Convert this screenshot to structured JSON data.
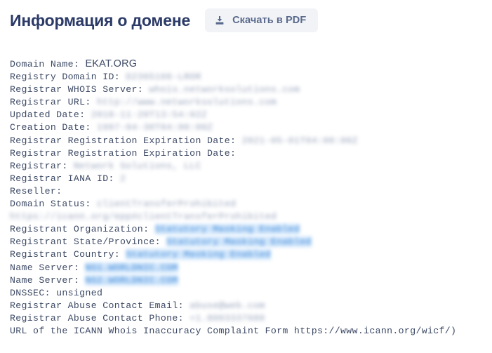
{
  "header": {
    "title": "Информация о домене",
    "pdf_button_label": "Скачать в PDF",
    "pdf_icon": "download-icon",
    "title_color": "#2b3a67",
    "button_bg": "#f1f3f7",
    "button_text_color": "#5a6a8c"
  },
  "whois": {
    "masked_value_color": "#8f9bb5",
    "highlight_value_color": "#2f7fd6",
    "highlight_bg_color": "#cfe5fb",
    "lines": [
      {
        "label": "Domain Name:",
        "value": "EKAT.ORG",
        "style": "domain"
      },
      {
        "label": "Registry Domain ID:",
        "value": "D2365166-LROR",
        "style": "masked"
      },
      {
        "label": "Registrar WHOIS Server:",
        "value": "whois.networksolutions.com",
        "style": "masked"
      },
      {
        "label": "Registrar URL:",
        "value": "http://www.networksolutions.com",
        "style": "masked"
      },
      {
        "label": "Updated Date:",
        "value": "2018-11-20T13:54:02Z",
        "style": "masked"
      },
      {
        "label": "Creation Date:",
        "value": "1997-04-30T04:00:00Z",
        "style": "masked"
      },
      {
        "label": "Registrar Registration Expiration Date:",
        "value": "2021-05-01T04:00:00Z",
        "style": "masked"
      },
      {
        "label": "Registrar Registration Expiration Date:",
        "value": "",
        "style": "masked"
      },
      {
        "label": "Registrar:",
        "value": "Network Solutions, LLC",
        "style": "masked"
      },
      {
        "label": "Registrar IANA ID:",
        "value": "2",
        "style": "masked"
      },
      {
        "label": "Reseller:",
        "value": "",
        "style": "masked"
      },
      {
        "label": "Domain Status:",
        "value": "clientTransferProhibited https://icann.org/epp#clientTransferProhibited",
        "style": "masked"
      },
      {
        "label": "Registrant Organization:",
        "value": "Statutory Masking Enabled",
        "style": "masked-selected"
      },
      {
        "label": "Registrant State/Province:",
        "value": "Statutory Masking Enabled",
        "style": "masked-selected"
      },
      {
        "label": "Registrant Country:",
        "value": "Statutory Masking Enabled",
        "style": "masked-selected"
      },
      {
        "label": "Name Server:",
        "value": "NS1.WORLDNIC.COM",
        "style": "masked-selected"
      },
      {
        "label": "Name Server:",
        "value": "NS2.WORLDNIC.COM",
        "style": "masked-selected"
      },
      {
        "label": "DNSSEC:",
        "value": "unsigned",
        "style": "plain"
      },
      {
        "label": "Registrar Abuse Contact Email:",
        "value": "abuse@web.com",
        "style": "masked"
      },
      {
        "label": "Registrar Abuse Contact Phone:",
        "value": "+1.8003337680",
        "style": "masked"
      },
      {
        "label": "URL of the ICANN Whois Inaccuracy Complaint Form https://www.icann.org/wicf/)",
        "value": "",
        "style": "plain"
      }
    ]
  }
}
